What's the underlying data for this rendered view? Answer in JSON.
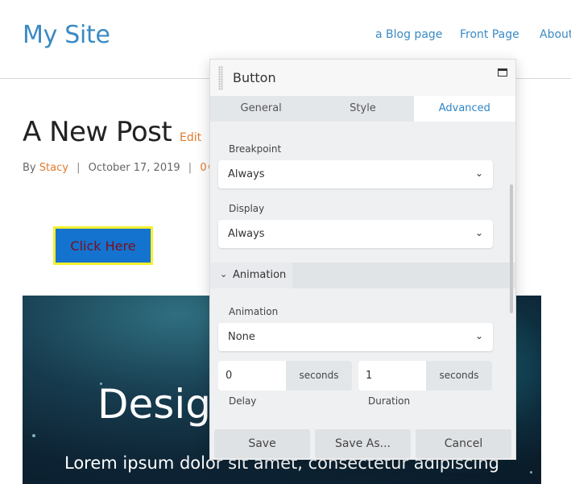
{
  "site": {
    "title": "My Site",
    "nav": [
      "a Blog page",
      "Front Page",
      "About"
    ]
  },
  "post": {
    "title": "A New Post",
    "edit_label": "Edit",
    "by_label": "By",
    "author": "Stacy",
    "date": "October 17, 2019",
    "comment_count": "0",
    "button_label": "Click Here",
    "hero_title": "Design",
    "hero_text": "Lorem ipsum dolor sit amet, consectetur adipiscing"
  },
  "panel": {
    "title": "Button",
    "tabs": [
      {
        "label": "General",
        "active": false
      },
      {
        "label": "Style",
        "active": false
      },
      {
        "label": "Advanced",
        "active": true
      }
    ],
    "breakpoint": {
      "label": "Breakpoint",
      "value": "Always"
    },
    "display": {
      "label": "Display",
      "value": "Always"
    },
    "section_title": "Animation",
    "animation": {
      "label": "Animation",
      "value": "None"
    },
    "delay": {
      "value": "0",
      "unit": "seconds",
      "label": "Delay"
    },
    "duration": {
      "value": "1",
      "unit": "seconds",
      "label": "Duration"
    },
    "buttons": {
      "save": "Save",
      "save_as": "Save As...",
      "cancel": "Cancel"
    }
  },
  "colors": {
    "accent": "#3a8ac4",
    "link": "#e07b2e",
    "button_bg": "#1473cf",
    "button_border": "#f4f030"
  }
}
